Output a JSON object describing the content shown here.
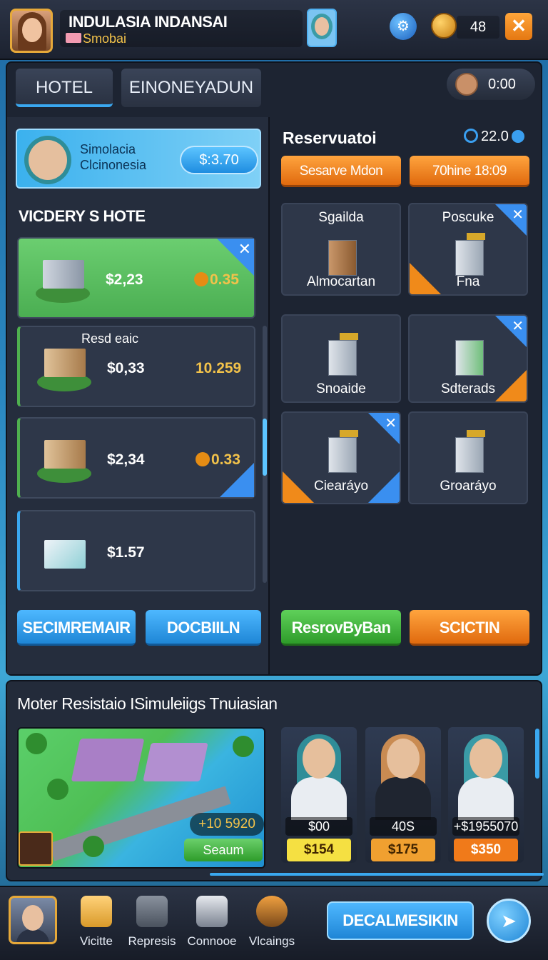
{
  "header": {
    "title": "INDULASIA INDANSAI",
    "subtitle": "Smobai",
    "coin_count": "48",
    "close_glyph": "✕"
  },
  "tabs": [
    {
      "label": "HOTEL"
    },
    {
      "label": "EINONEYADUN"
    }
  ],
  "time_display": "0:00",
  "left": {
    "promo_line1": "Simolacia",
    "promo_line2": "Clcinonesia",
    "promo_button": "$:3.70",
    "section_title": "VICDERY S HOTE",
    "rows": [
      {
        "price": "$2,23",
        "value": "0.35",
        "tag": ""
      },
      {
        "price": "$0,33",
        "value": "10.259",
        "tag": "Resd eaic"
      },
      {
        "price": "$2,34",
        "value": "0.33",
        "tag": ""
      },
      {
        "price": "$1.57",
        "value": "",
        "tag": ""
      }
    ],
    "btn_left": "SECIMREMAIR",
    "btn_right": "DOCBIILN"
  },
  "right": {
    "title": "Reservuatoi",
    "count": "22.0",
    "btn_left": "Sesarve Mdon",
    "btn_right": "70hine 18:09",
    "tiles": [
      {
        "top": "Sgailda",
        "bottom": "Almocartan"
      },
      {
        "top": "Poscuke",
        "bottom": "Fna"
      },
      {
        "top": "",
        "bottom": "Snoaide"
      },
      {
        "top": "",
        "bottom": "Sdterads"
      },
      {
        "top": "",
        "bottom": "Ciearáyo"
      },
      {
        "top": "",
        "bottom": "Groaráyo"
      }
    ],
    "btn_green": "ResrovByBan",
    "btn_orange": "SCICTIN"
  },
  "bottom": {
    "title": "Moter Resistaio ISimuleiigs Tnuiasian",
    "map_earn": "+10 5920",
    "map_btn": "Seaum",
    "staff": [
      {
        "stat": "$00",
        "cost": "$154",
        "cost_color": "#f5e042"
      },
      {
        "stat": "40S",
        "cost": "$175",
        "cost_color": "#f0a030"
      },
      {
        "stat": "+$1955070",
        "cost": "$350",
        "cost_color": "#f07a1a"
      }
    ]
  },
  "nav": {
    "items": [
      {
        "label": "Vicitte"
      },
      {
        "label": "Represis"
      },
      {
        "label": "Connooe"
      },
      {
        "label": "Vlcaings"
      }
    ],
    "main_button": "DECALMESIKIN"
  },
  "colors": {
    "accent_blue": "#3aa8f0",
    "accent_orange": "#f08a1a",
    "accent_green": "#4fb04f",
    "gold": "#f2c24a"
  }
}
